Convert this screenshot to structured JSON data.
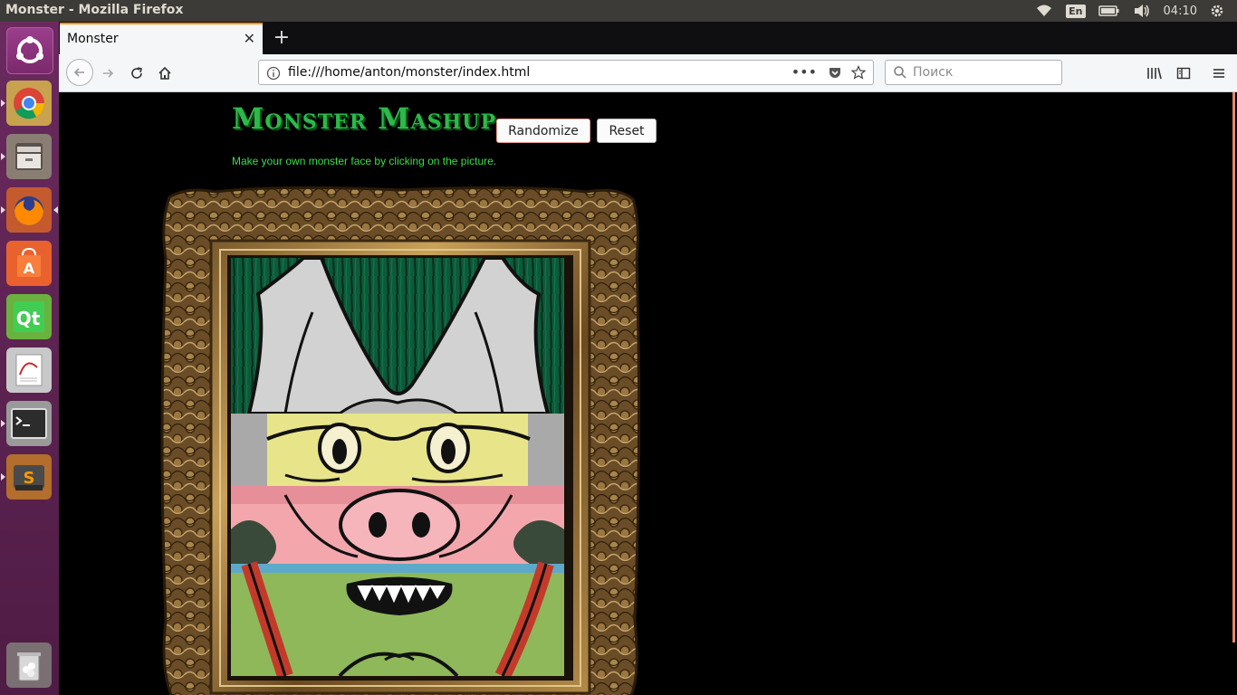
{
  "window": {
    "title": "Monster - Mozilla Firefox"
  },
  "tray": {
    "language": "En",
    "clock": "04:10"
  },
  "launcher": {
    "items": [
      {
        "name": "ubuntu-dash",
        "icon": "ubuntu-logo-icon"
      },
      {
        "name": "chrome",
        "icon": "chrome-icon"
      },
      {
        "name": "files",
        "icon": "files-icon"
      },
      {
        "name": "firefox",
        "icon": "firefox-icon"
      },
      {
        "name": "software-center",
        "icon": "software-center-icon"
      },
      {
        "name": "qt-creator",
        "icon": "qt-icon"
      },
      {
        "name": "document-viewer",
        "icon": "document-viewer-icon"
      },
      {
        "name": "terminal",
        "icon": "terminal-icon"
      },
      {
        "name": "sublime-text",
        "icon": "sublime-icon"
      },
      {
        "name": "trash",
        "icon": "trash-icon"
      }
    ]
  },
  "browser": {
    "tab": {
      "title": "Monster"
    },
    "url": "file:///home/anton/monster/index.html",
    "search_placeholder": "Поиск"
  },
  "page": {
    "title": "Monster Mashup",
    "randomize_label": "Randomize",
    "reset_label": "Reset",
    "subtitle": "Make your own monster face by clicking on the picture.",
    "strips": [
      {
        "name": "monster-top-strip"
      },
      {
        "name": "monster-eyes-strip"
      },
      {
        "name": "monster-nose-strip"
      },
      {
        "name": "monster-mouth-strip"
      }
    ]
  },
  "colors": {
    "title_green": "#2db84a",
    "subtitle_green": "#3ddc4b",
    "launcher_purple": "#5c2150",
    "tab_accent": "#ff9400"
  }
}
